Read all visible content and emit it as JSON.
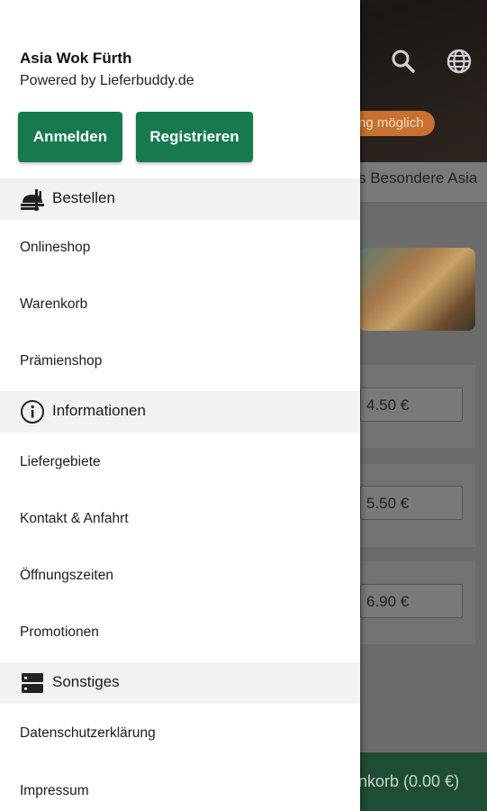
{
  "background": {
    "tab_text": "s Besondere Asia",
    "badge_text": "ng möglich",
    "prices": [
      "4.50 €",
      "5.50 €",
      "6.90 €"
    ],
    "cart_text": "nkorb (0.00 €)"
  },
  "drawer": {
    "shop_name": "Asia Wok Fürth",
    "powered_by": "Powered by Lieferbuddy.de",
    "login_label": "Anmelden",
    "register_label": "Registrieren",
    "sections": [
      {
        "title": "Bestellen",
        "icon": "food-tray-icon",
        "items": [
          "Onlineshop",
          "Warenkorb",
          "Prämienshop"
        ]
      },
      {
        "title": "Informationen",
        "icon": "info-icon",
        "items": [
          "Liefergebiete",
          "Kontakt & Anfahrt",
          "Öffnungszeiten",
          "Promotionen"
        ]
      },
      {
        "title": "Sonstiges",
        "icon": "server-icon",
        "items": [
          "Datenschutzerklärung",
          "Impressum"
        ]
      }
    ]
  },
  "colors": {
    "primary": "#177a4f",
    "badge": "#c9712f"
  }
}
